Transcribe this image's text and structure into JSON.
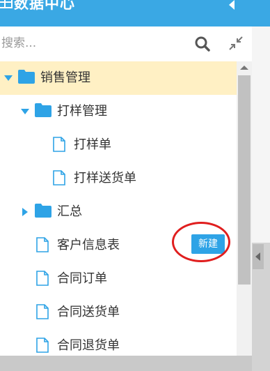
{
  "header": {
    "title": "数据中心",
    "grid_icon": "grid-icon",
    "collapse_icon": "caret-left-icon"
  },
  "search": {
    "placeholder": "搜索...",
    "search_icon": "search-icon",
    "collapse_all_icon": "shrink-icon"
  },
  "tree": {
    "nodes": [
      {
        "label": "销售管理",
        "type": "folder",
        "expanded": true,
        "selected": true,
        "level": 0
      },
      {
        "label": "打样管理",
        "type": "folder",
        "expanded": true,
        "level": 1
      },
      {
        "label": "打样单",
        "type": "file",
        "level": 2
      },
      {
        "label": "打样送货单",
        "type": "file",
        "level": 2
      },
      {
        "label": "汇总",
        "type": "folder",
        "expanded": false,
        "level": 1
      },
      {
        "label": "客户信息表",
        "type": "file",
        "level": 1
      },
      {
        "label": "合同订单",
        "type": "file",
        "level": 1
      },
      {
        "label": "合同送货单",
        "type": "file",
        "level": 1
      },
      {
        "label": "合同退货单",
        "type": "file",
        "level": 1
      }
    ]
  },
  "actions": {
    "new_label": "新建"
  },
  "colors": {
    "header": "#3aa8e4",
    "accent": "#2ea3e6",
    "selected_row": "#fff0c4",
    "highlight": "#e01e1e"
  }
}
